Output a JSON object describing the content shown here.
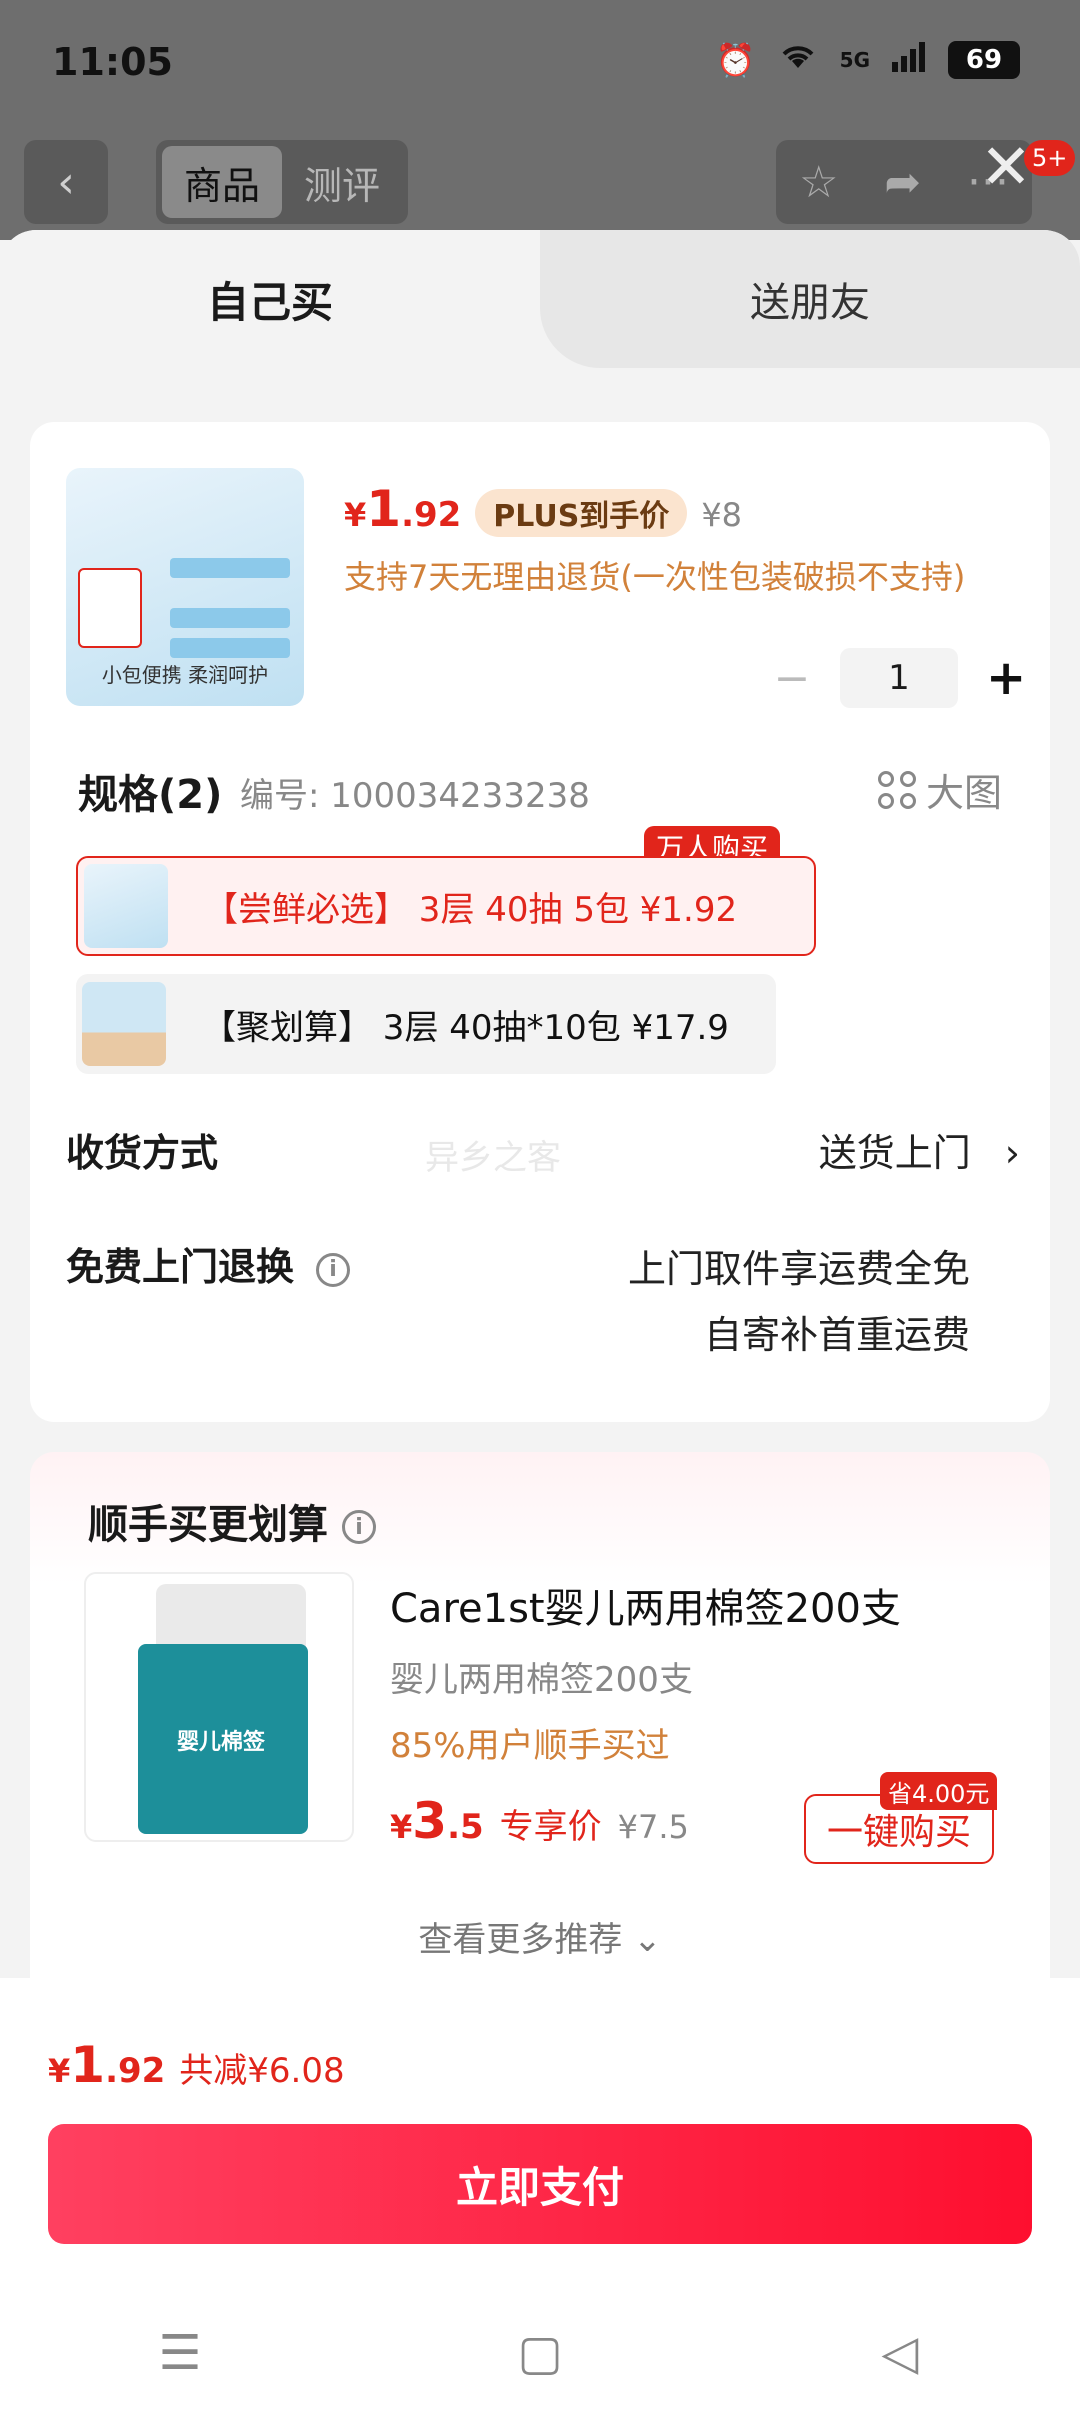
{
  "status_bar": {
    "time": "11:05",
    "network": "5G",
    "battery": "69"
  },
  "topbar": {
    "segments": [
      "商品",
      "测评"
    ],
    "active_segment": "商品",
    "badge": "5+"
  },
  "sheet": {
    "tabs": {
      "self": "自己买",
      "friend": "送朋友"
    },
    "product": {
      "price_symbol": "¥",
      "price_int": "1",
      "price_dec": ".92",
      "plus_tag": "PLUS到手价",
      "original_price": "¥8",
      "return_policy": "支持7天无理由退货(一次性包装破损不支持)",
      "image_caption": "小包便携 柔润呵护",
      "quantity": "1"
    },
    "spec": {
      "title": "规格(2)",
      "code": "编号: 100034233238",
      "big_image": "大图",
      "options": [
        {
          "label": "【尝鲜必选】 3层 40抽 5包  ¥1.92",
          "badge": "万人购买",
          "selected": true
        },
        {
          "label": "【聚划算】 3层 40抽*10包  ¥17.9",
          "selected": false
        }
      ]
    },
    "delivery": {
      "label": "收货方式",
      "value": "送货上门",
      "arrow": "›"
    },
    "return_service": {
      "label": "免费上门退换",
      "info_icon": "i",
      "line1": "上门取件享运费全免",
      "line2": "自寄补首重运费"
    },
    "watermark": "异乡之客",
    "recommend": {
      "title": "顺手买更划算",
      "item_name": "Care1st婴儿两用棉签200支",
      "item_sub": "婴儿两用棉签200支",
      "bought": "85%用户顺手买过",
      "price_symbol": "¥",
      "price_int": "3",
      "price_dec": ".5",
      "exclusive": "专享价",
      "original_price": "¥7.5",
      "save_badge": "省4.00元",
      "buy_label": "一键购买",
      "image_label": "婴儿棉签",
      "more": "查看更多推荐 ⌄"
    },
    "footer": {
      "total_symbol": "¥",
      "total_int": "1",
      "total_dec": ".92",
      "total_save": "共减¥6.08",
      "pay_label": "立即支付"
    }
  },
  "colors": {
    "accent": "#e1251b",
    "orange_text": "#d1813a",
    "plus_bg": "#fbe4cf"
  }
}
